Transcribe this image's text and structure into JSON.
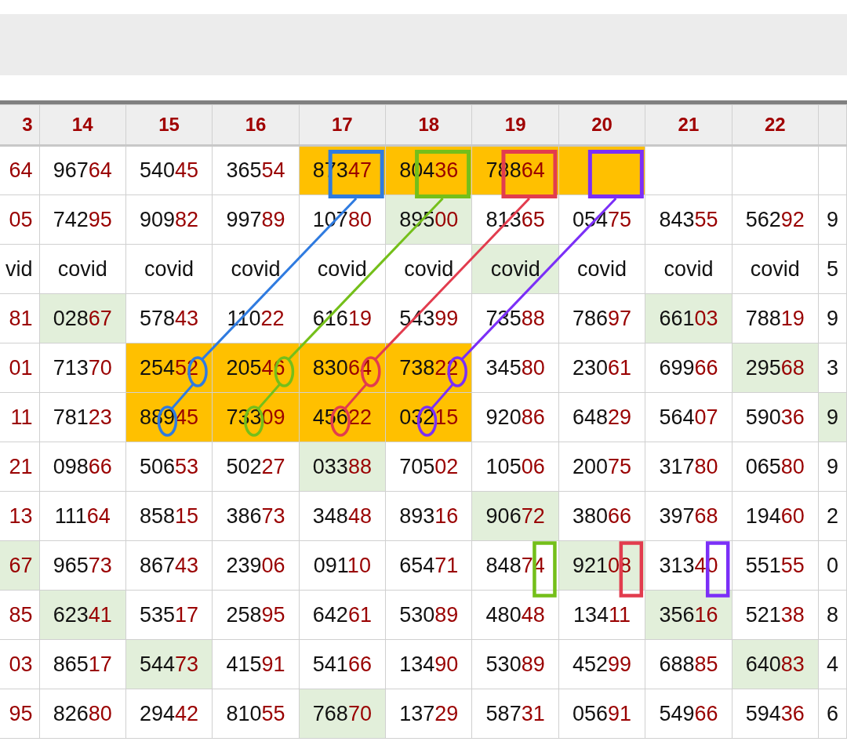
{
  "table": {
    "columns": [
      "3",
      "14",
      "15",
      "16",
      "17",
      "18",
      "19",
      "20",
      "21",
      "22"
    ],
    "rows": [
      {
        "cells": [
          {
            "tail": "64"
          },
          {
            "head": "967",
            "tail": "64"
          },
          {
            "head": "540",
            "tail": "45"
          },
          {
            "head": "365",
            "tail": "54"
          },
          {
            "head": "873",
            "tail": "47",
            "color": "#ffc000"
          },
          {
            "head": "804",
            "tail": "36",
            "color": "#ffc000"
          },
          {
            "head": "788",
            "tail": "64",
            "color": "#ffc000"
          },
          {
            "color": "#ffc000"
          },
          {},
          {},
          {}
        ]
      },
      {
        "cells": [
          {
            "tail": "05"
          },
          {
            "head": "742",
            "tail": "95"
          },
          {
            "head": "909",
            "tail": "82"
          },
          {
            "head": "997",
            "tail": "89"
          },
          {
            "head": "107",
            "tail": "80"
          },
          {
            "head": "895",
            "tail": "00",
            "color": "#e2efda"
          },
          {
            "head": "813",
            "tail": "65"
          },
          {
            "head": "054",
            "tail": "75"
          },
          {
            "head": "843",
            "tail": "55"
          },
          {
            "head": "562",
            "tail": "92"
          },
          {
            "head": "9"
          }
        ]
      },
      {
        "cells": [
          {
            "head": "vid"
          },
          {
            "head": "covid"
          },
          {
            "head": "covid"
          },
          {
            "head": "covid"
          },
          {
            "head": "covid"
          },
          {
            "head": "covid"
          },
          {
            "head": "covid",
            "color": "#e2efda"
          },
          {
            "head": "covid"
          },
          {
            "head": "covid"
          },
          {
            "head": "covid"
          },
          {
            "head": "5"
          }
        ]
      },
      {
        "cells": [
          {
            "tail": "81"
          },
          {
            "head": "028",
            "tail": "67",
            "color": "#e2efda"
          },
          {
            "head": "578",
            "tail": "43"
          },
          {
            "head": "110",
            "tail": "22"
          },
          {
            "head": "616",
            "tail": "19"
          },
          {
            "head": "543",
            "tail": "99"
          },
          {
            "head": "735",
            "tail": "88"
          },
          {
            "head": "786",
            "tail": "97"
          },
          {
            "head": "661",
            "tail": "03",
            "color": "#e2efda"
          },
          {
            "head": "788",
            "tail": "19"
          },
          {
            "head": "9"
          }
        ]
      },
      {
        "cells": [
          {
            "tail": "01"
          },
          {
            "head": "713",
            "tail": "70"
          },
          {
            "head": "254",
            "tail": "52",
            "color": "#ffc000"
          },
          {
            "head": "205",
            "tail": "46",
            "color": "#ffc000"
          },
          {
            "head": "830",
            "tail": "64",
            "color": "#ffc000"
          },
          {
            "head": "738",
            "tail": "22",
            "color": "#ffc000"
          },
          {
            "head": "345",
            "tail": "80"
          },
          {
            "head": "230",
            "tail": "61"
          },
          {
            "head": "699",
            "tail": "66"
          },
          {
            "head": "295",
            "tail": "68",
            "color": "#e2efda"
          },
          {
            "head": "3"
          }
        ]
      },
      {
        "cells": [
          {
            "tail": "11"
          },
          {
            "head": "781",
            "tail": "23"
          },
          {
            "head": "889",
            "tail": "45",
            "color": "#ffc000"
          },
          {
            "head": "733",
            "tail": "09",
            "color": "#ffc000"
          },
          {
            "head": "456",
            "tail": "22",
            "color": "#ffc000"
          },
          {
            "head": "032",
            "tail": "15",
            "color": "#ffc000"
          },
          {
            "head": "920",
            "tail": "86"
          },
          {
            "head": "648",
            "tail": "29"
          },
          {
            "head": "564",
            "tail": "07"
          },
          {
            "head": "590",
            "tail": "36"
          },
          {
            "head": "9",
            "color": "#e2efda"
          }
        ]
      },
      {
        "cells": [
          {
            "tail": "21"
          },
          {
            "head": "098",
            "tail": "66"
          },
          {
            "head": "506",
            "tail": "53"
          },
          {
            "head": "502",
            "tail": "27"
          },
          {
            "head": "033",
            "tail": "88",
            "color": "#e2efda"
          },
          {
            "head": "705",
            "tail": "02"
          },
          {
            "head": "105",
            "tail": "06"
          },
          {
            "head": "200",
            "tail": "75"
          },
          {
            "head": "317",
            "tail": "80"
          },
          {
            "head": "065",
            "tail": "80"
          },
          {
            "head": "9"
          }
        ]
      },
      {
        "cells": [
          {
            "tail": "13"
          },
          {
            "head": "111",
            "tail": "64"
          },
          {
            "head": "858",
            "tail": "15"
          },
          {
            "head": "386",
            "tail": "73"
          },
          {
            "head": "348",
            "tail": "48"
          },
          {
            "head": "893",
            "tail": "16"
          },
          {
            "head": "906",
            "tail": "72",
            "color": "#e2efda"
          },
          {
            "head": "380",
            "tail": "66"
          },
          {
            "head": "397",
            "tail": "68"
          },
          {
            "head": "194",
            "tail": "60"
          },
          {
            "head": "2"
          }
        ]
      },
      {
        "cells": [
          {
            "tail": "67",
            "color": "#e2efda"
          },
          {
            "head": "965",
            "tail": "73"
          },
          {
            "head": "867",
            "tail": "43"
          },
          {
            "head": "239",
            "tail": "06"
          },
          {
            "head": "091",
            "tail": "10"
          },
          {
            "head": "654",
            "tail": "71"
          },
          {
            "head": "848",
            "tail": "74"
          },
          {
            "head": "921",
            "tail": "08",
            "color": "#e2efda"
          },
          {
            "head": "313",
            "tail": "40"
          },
          {
            "head": "551",
            "tail": "55"
          },
          {
            "head": "0"
          }
        ]
      },
      {
        "cells": [
          {
            "tail": "85"
          },
          {
            "head": "623",
            "tail": "41",
            "color": "#e2efda"
          },
          {
            "head": "535",
            "tail": "17"
          },
          {
            "head": "258",
            "tail": "95"
          },
          {
            "head": "642",
            "tail": "61"
          },
          {
            "head": "530",
            "tail": "89"
          },
          {
            "head": "480",
            "tail": "48"
          },
          {
            "head": "134",
            "tail": "11"
          },
          {
            "head": "356",
            "tail": "16",
            "color": "#e2efda"
          },
          {
            "head": "521",
            "tail": "38"
          },
          {
            "head": "8"
          }
        ]
      },
      {
        "cells": [
          {
            "tail": "03"
          },
          {
            "head": "865",
            "tail": "17"
          },
          {
            "head": "544",
            "tail": "73",
            "color": "#e2efda"
          },
          {
            "head": "415",
            "tail": "91"
          },
          {
            "head": "541",
            "tail": "66"
          },
          {
            "head": "134",
            "tail": "90"
          },
          {
            "head": "530",
            "tail": "89"
          },
          {
            "head": "452",
            "tail": "99"
          },
          {
            "head": "688",
            "tail": "85"
          },
          {
            "head": "640",
            "tail": "83",
            "color": "#e2efda"
          },
          {
            "head": "4"
          }
        ]
      },
      {
        "cells": [
          {
            "tail": "95"
          },
          {
            "head": "826",
            "tail": "80"
          },
          {
            "head": "294",
            "tail": "42"
          },
          {
            "head": "810",
            "tail": "55"
          },
          {
            "head": "768",
            "tail": "70",
            "color": "#e2efda"
          },
          {
            "head": "137",
            "tail": "29"
          },
          {
            "head": "587",
            "tail": "31"
          },
          {
            "head": "056",
            "tail": "91"
          },
          {
            "head": "549",
            "tail": "66"
          },
          {
            "head": "594",
            "tail": "36"
          },
          {
            "head": "6"
          }
        ]
      }
    ]
  },
  "annotations": [
    {
      "color": "#2f7be0"
    },
    {
      "color": "#74bf1a"
    },
    {
      "color": "#e23c4e"
    },
    {
      "color": "#7b2ff7"
    }
  ]
}
